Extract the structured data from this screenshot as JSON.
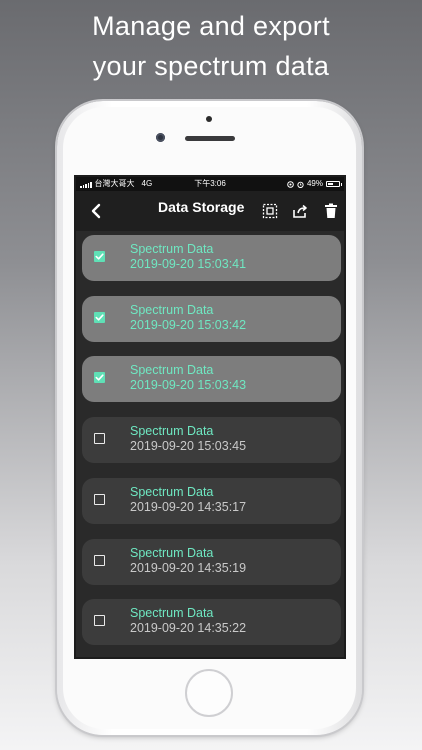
{
  "headline": {
    "line1": "Manage and export",
    "line2": "your spectrum data"
  },
  "status_bar": {
    "carrier": "台灣大哥大",
    "network": "4G",
    "time": "下午3:06",
    "battery": "49%",
    "battery_level": 0.49
  },
  "nav": {
    "title": "Data Storage",
    "icons": [
      "back-chevron-icon",
      "select-all-icon",
      "share-icon",
      "trash-icon"
    ]
  },
  "colors": {
    "accent": "#6fe8c2",
    "checked_card": "#7d7d7d",
    "unchecked_card": "#3c3c3c",
    "screen_bg": "#2a2a2a"
  },
  "records": [
    {
      "title": "Spectrum Data",
      "date": "2019-09-20 15:03:41",
      "checked": true
    },
    {
      "title": "Spectrum Data",
      "date": "2019-09-20 15:03:42",
      "checked": true
    },
    {
      "title": "Spectrum Data",
      "date": "2019-09-20 15:03:43",
      "checked": true
    },
    {
      "title": "Spectrum Data",
      "date": "2019-09-20 15:03:45",
      "checked": false
    },
    {
      "title": "Spectrum Data",
      "date": "2019-09-20 14:35:17",
      "checked": false
    },
    {
      "title": "Spectrum Data",
      "date": "2019-09-20 14:35:19",
      "checked": false
    },
    {
      "title": "Spectrum Data",
      "date": "2019-09-20 14:35:22",
      "checked": false
    }
  ]
}
